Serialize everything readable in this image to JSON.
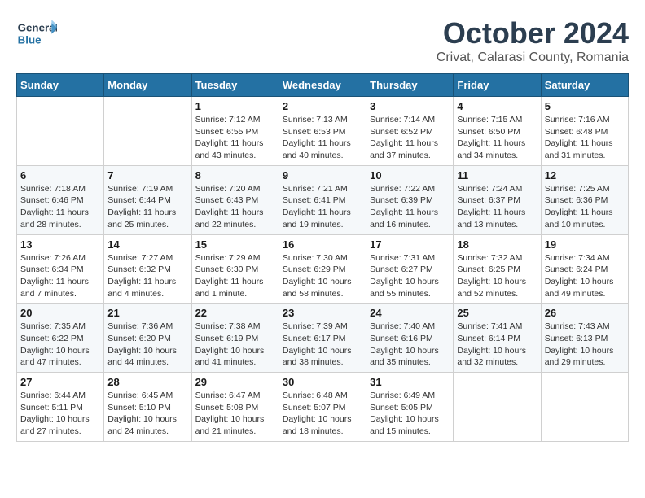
{
  "header": {
    "logo_general": "General",
    "logo_blue": "Blue",
    "month_title": "October 2024",
    "location": "Crivat, Calarasi County, Romania"
  },
  "weekdays": [
    "Sunday",
    "Monday",
    "Tuesday",
    "Wednesday",
    "Thursday",
    "Friday",
    "Saturday"
  ],
  "weeks": [
    [
      {
        "day": "",
        "content": ""
      },
      {
        "day": "",
        "content": ""
      },
      {
        "day": "1",
        "content": "Sunrise: 7:12 AM\nSunset: 6:55 PM\nDaylight: 11 hours and 43 minutes."
      },
      {
        "day": "2",
        "content": "Sunrise: 7:13 AM\nSunset: 6:53 PM\nDaylight: 11 hours and 40 minutes."
      },
      {
        "day": "3",
        "content": "Sunrise: 7:14 AM\nSunset: 6:52 PM\nDaylight: 11 hours and 37 minutes."
      },
      {
        "day": "4",
        "content": "Sunrise: 7:15 AM\nSunset: 6:50 PM\nDaylight: 11 hours and 34 minutes."
      },
      {
        "day": "5",
        "content": "Sunrise: 7:16 AM\nSunset: 6:48 PM\nDaylight: 11 hours and 31 minutes."
      }
    ],
    [
      {
        "day": "6",
        "content": "Sunrise: 7:18 AM\nSunset: 6:46 PM\nDaylight: 11 hours and 28 minutes."
      },
      {
        "day": "7",
        "content": "Sunrise: 7:19 AM\nSunset: 6:44 PM\nDaylight: 11 hours and 25 minutes."
      },
      {
        "day": "8",
        "content": "Sunrise: 7:20 AM\nSunset: 6:43 PM\nDaylight: 11 hours and 22 minutes."
      },
      {
        "day": "9",
        "content": "Sunrise: 7:21 AM\nSunset: 6:41 PM\nDaylight: 11 hours and 19 minutes."
      },
      {
        "day": "10",
        "content": "Sunrise: 7:22 AM\nSunset: 6:39 PM\nDaylight: 11 hours and 16 minutes."
      },
      {
        "day": "11",
        "content": "Sunrise: 7:24 AM\nSunset: 6:37 PM\nDaylight: 11 hours and 13 minutes."
      },
      {
        "day": "12",
        "content": "Sunrise: 7:25 AM\nSunset: 6:36 PM\nDaylight: 11 hours and 10 minutes."
      }
    ],
    [
      {
        "day": "13",
        "content": "Sunrise: 7:26 AM\nSunset: 6:34 PM\nDaylight: 11 hours and 7 minutes."
      },
      {
        "day": "14",
        "content": "Sunrise: 7:27 AM\nSunset: 6:32 PM\nDaylight: 11 hours and 4 minutes."
      },
      {
        "day": "15",
        "content": "Sunrise: 7:29 AM\nSunset: 6:30 PM\nDaylight: 11 hours and 1 minute."
      },
      {
        "day": "16",
        "content": "Sunrise: 7:30 AM\nSunset: 6:29 PM\nDaylight: 10 hours and 58 minutes."
      },
      {
        "day": "17",
        "content": "Sunrise: 7:31 AM\nSunset: 6:27 PM\nDaylight: 10 hours and 55 minutes."
      },
      {
        "day": "18",
        "content": "Sunrise: 7:32 AM\nSunset: 6:25 PM\nDaylight: 10 hours and 52 minutes."
      },
      {
        "day": "19",
        "content": "Sunrise: 7:34 AM\nSunset: 6:24 PM\nDaylight: 10 hours and 49 minutes."
      }
    ],
    [
      {
        "day": "20",
        "content": "Sunrise: 7:35 AM\nSunset: 6:22 PM\nDaylight: 10 hours and 47 minutes."
      },
      {
        "day": "21",
        "content": "Sunrise: 7:36 AM\nSunset: 6:20 PM\nDaylight: 10 hours and 44 minutes."
      },
      {
        "day": "22",
        "content": "Sunrise: 7:38 AM\nSunset: 6:19 PM\nDaylight: 10 hours and 41 minutes."
      },
      {
        "day": "23",
        "content": "Sunrise: 7:39 AM\nSunset: 6:17 PM\nDaylight: 10 hours and 38 minutes."
      },
      {
        "day": "24",
        "content": "Sunrise: 7:40 AM\nSunset: 6:16 PM\nDaylight: 10 hours and 35 minutes."
      },
      {
        "day": "25",
        "content": "Sunrise: 7:41 AM\nSunset: 6:14 PM\nDaylight: 10 hours and 32 minutes."
      },
      {
        "day": "26",
        "content": "Sunrise: 7:43 AM\nSunset: 6:13 PM\nDaylight: 10 hours and 29 minutes."
      }
    ],
    [
      {
        "day": "27",
        "content": "Sunrise: 6:44 AM\nSunset: 5:11 PM\nDaylight: 10 hours and 27 minutes."
      },
      {
        "day": "28",
        "content": "Sunrise: 6:45 AM\nSunset: 5:10 PM\nDaylight: 10 hours and 24 minutes."
      },
      {
        "day": "29",
        "content": "Sunrise: 6:47 AM\nSunset: 5:08 PM\nDaylight: 10 hours and 21 minutes."
      },
      {
        "day": "30",
        "content": "Sunrise: 6:48 AM\nSunset: 5:07 PM\nDaylight: 10 hours and 18 minutes."
      },
      {
        "day": "31",
        "content": "Sunrise: 6:49 AM\nSunset: 5:05 PM\nDaylight: 10 hours and 15 minutes."
      },
      {
        "day": "",
        "content": ""
      },
      {
        "day": "",
        "content": ""
      }
    ]
  ]
}
